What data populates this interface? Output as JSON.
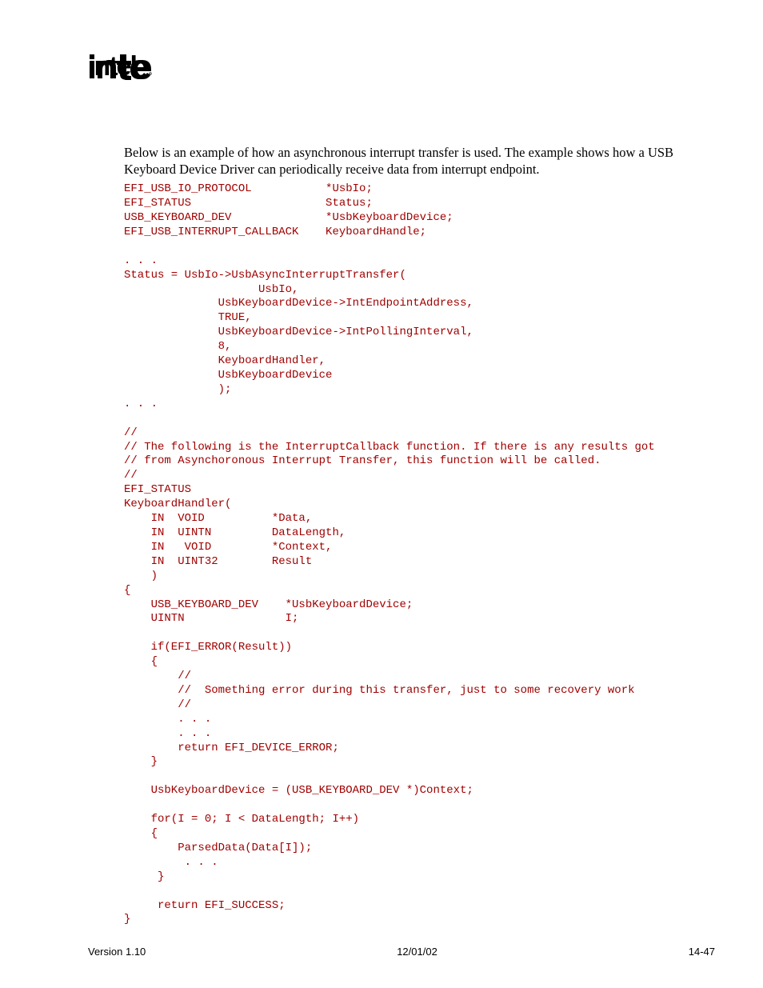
{
  "paragraph": "Below is an example of how an asynchronous interrupt transfer is used.  The example shows how a USB Keyboard Device Driver can periodically receive data from interrupt endpoint.",
  "code": "EFI_USB_IO_PROTOCOL           *UsbIo;\nEFI_STATUS                    Status;\nUSB_KEYBOARD_DEV              *UsbKeyboardDevice;\nEFI_USB_INTERRUPT_CALLBACK    KeyboardHandle;\n\n. . .\nStatus = UsbIo->UsbAsyncInterruptTransfer(\n                    UsbIo,\n              UsbKeyboardDevice->IntEndpointAddress,\n              TRUE,\n              UsbKeyboardDevice->IntPollingInterval,\n              8,\n              KeyboardHandler,\n              UsbKeyboardDevice\n              );\n. . .\n\n//\n// The following is the InterruptCallback function. If there is any results got\n// from Asynchoronous Interrupt Transfer, this function will be called.\n//\nEFI_STATUS\nKeyboardHandler(\n    IN  VOID          *Data,\n    IN  UINTN         DataLength,\n    IN   VOID         *Context,\n    IN  UINT32        Result\n    )\n{\n    USB_KEYBOARD_DEV    *UsbKeyboardDevice;\n    UINTN               I;\n\n    if(EFI_ERROR(Result))\n    {\n        //\n        //  Something error during this transfer, just to some recovery work\n        //\n        . . .\n        . . .\n        return EFI_DEVICE_ERROR;\n    }\n\n    UsbKeyboardDevice = (USB_KEYBOARD_DEV *)Context;\n\n    for(I = 0; I < DataLength; I++)\n    {\n        ParsedData(Data[I]);\n         . . .\n     }\n\n     return EFI_SUCCESS;\n}",
  "footer": {
    "version": "Version 1.10",
    "date": "12/01/02",
    "page": "14-47"
  }
}
